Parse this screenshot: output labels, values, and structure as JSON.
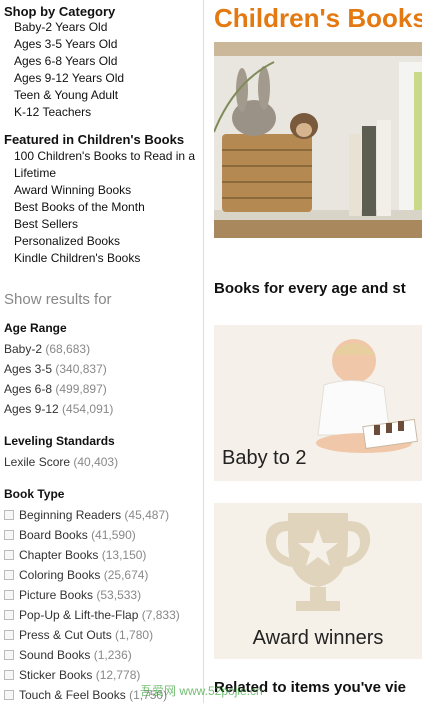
{
  "shop_by_category": {
    "title": "Shop by Category",
    "items": [
      "Baby-2 Years Old",
      "Ages 3-5 Years Old",
      "Ages 6-8 Years Old",
      "Ages 9-12 Years Old",
      "Teen & Young Adult",
      "K-12 Teachers"
    ]
  },
  "featured": {
    "title": "Featured in Children's Books",
    "items": [
      "100 Children's Books to Read in a Lifetime",
      "Award Winning Books",
      "Best Books of the Month",
      "Best Sellers",
      "Personalized Books",
      "Kindle Children's Books"
    ]
  },
  "show_results": "Show results for",
  "age_range": {
    "title": "Age Range",
    "items": [
      {
        "label": "Baby-2",
        "count": "(68,683)"
      },
      {
        "label": "Ages 3-5",
        "count": "(340,837)"
      },
      {
        "label": "Ages 6-8",
        "count": "(499,897)"
      },
      {
        "label": "Ages 9-12",
        "count": "(454,091)"
      }
    ]
  },
  "leveling": {
    "title": "Leveling Standards",
    "items": [
      {
        "label": "Lexile Score",
        "count": "(40,403)"
      }
    ]
  },
  "book_type": {
    "title": "Book Type",
    "items": [
      {
        "label": "Beginning Readers",
        "count": "(45,487)"
      },
      {
        "label": "Board Books",
        "count": "(41,590)"
      },
      {
        "label": "Chapter Books",
        "count": "(13,150)"
      },
      {
        "label": "Coloring Books",
        "count": "(25,674)"
      },
      {
        "label": "Picture Books",
        "count": "(53,533)"
      },
      {
        "label": "Pop-Up & Lift-the-Flap",
        "count": "(7,833)"
      },
      {
        "label": "Press & Cut Outs",
        "count": "(1,780)"
      },
      {
        "label": "Sound Books",
        "count": "(1,236)"
      },
      {
        "label": "Sticker Books",
        "count": "(12,778)"
      },
      {
        "label": "Touch & Feel Books",
        "count": "(1,750)"
      }
    ]
  },
  "main": {
    "title": "Children's Books",
    "subtitle": "Books for every age and st",
    "tiles": [
      {
        "label": "Baby to 2"
      },
      {
        "label": "Award winners"
      }
    ],
    "related": "Related to items you've vie"
  },
  "watermark": "吾爱网 www.52pojie.cn",
  "colors": {
    "accent": "#e47911",
    "count": "#888888"
  }
}
